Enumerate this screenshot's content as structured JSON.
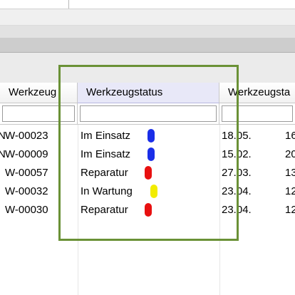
{
  "columns": {
    "werkzeug": "Werkzeug",
    "status": "Werkzeugstatus",
    "date": "Werkzeugsta"
  },
  "rows": [
    {
      "werkzeug": "W-00023",
      "prefix": "N",
      "status": "Im Einsatz",
      "status_color": "#1a2ee8",
      "date": "18.05.",
      "extra": "16"
    },
    {
      "werkzeug": "W-00009",
      "prefix": "N",
      "status": "Im Einsatz",
      "status_color": "#1a2ee8",
      "date": "15.02.",
      "extra": "20"
    },
    {
      "werkzeug": "W-00057",
      "prefix": "",
      "status": "Reparatur",
      "status_color": "#e81010",
      "date": "27.03.",
      "extra": "13"
    },
    {
      "werkzeug": "W-00032",
      "prefix": "",
      "status": "In Wartung",
      "status_color": "#f2ec00",
      "date": "23.04.",
      "extra": "12"
    },
    {
      "werkzeug": "W-00030",
      "prefix": "",
      "status": "Reparatur",
      "status_color": "#e81010",
      "date": "23.04.",
      "extra": "12"
    }
  ],
  "colors": {
    "highlight": "#6a9136",
    "selected_header": "#e8e8f8"
  }
}
